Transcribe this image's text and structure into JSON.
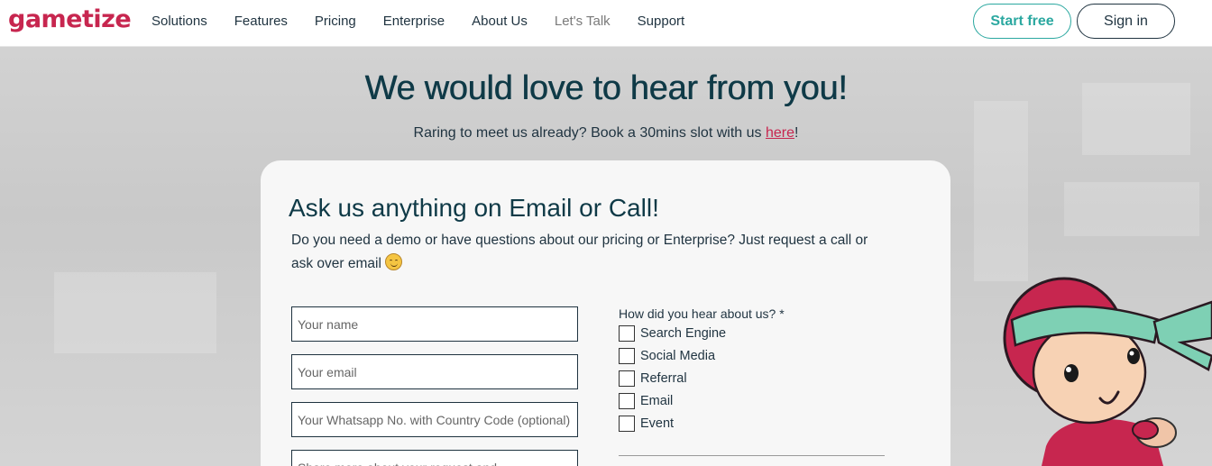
{
  "header": {
    "logo": "gametize",
    "nav": [
      {
        "label": "Solutions"
      },
      {
        "label": "Features"
      },
      {
        "label": "Pricing"
      },
      {
        "label": "Enterprise"
      },
      {
        "label": "About Us"
      },
      {
        "label": "Let's Talk"
      },
      {
        "label": "Support"
      }
    ],
    "start_label": "Start free",
    "signin_label": "Sign in"
  },
  "hero": {
    "title": "We would love to hear from you!",
    "sub_before": "Raring to meet us already? Book a 30mins slot with us ",
    "sub_link": "here",
    "sub_after": "!"
  },
  "card": {
    "title": "Ask us anything on Email or Call!",
    "desc": "Do you need a demo or have questions about our pricing or Enterprise? Just request a call or ask over email",
    "fields": {
      "name_placeholder": "Your name",
      "email_placeholder": "Your email",
      "whatsapp_placeholder": "Your Whatsapp No. with Country Code (optional)",
      "message_placeholder": "Share more about your request and"
    },
    "question": "How did you hear about us? *",
    "options": [
      "Search Engine",
      "Social Media",
      "Referral",
      "Email",
      "Event"
    ]
  },
  "colors": {
    "brand": "#c7264f",
    "accent": "#2ba8a0",
    "text": "#1f3340",
    "heading": "#0f3a47"
  }
}
